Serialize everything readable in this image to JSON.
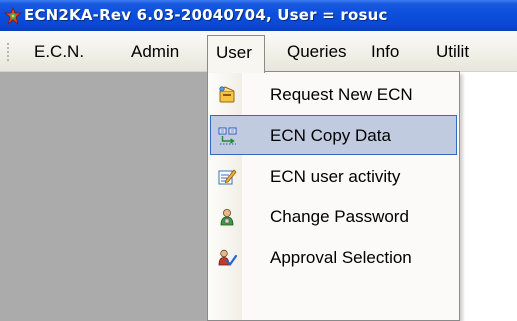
{
  "window": {
    "title": "ECN2KA-Rev 6.03-20040704, User = rosuc"
  },
  "menubar": {
    "items": [
      {
        "label": "E.C.N."
      },
      {
        "label": "Admin"
      },
      {
        "label": "User",
        "state": "open"
      },
      {
        "label": "Queries"
      },
      {
        "label": "Info"
      },
      {
        "label": "Utilit"
      }
    ]
  },
  "user_menu": {
    "items": [
      {
        "label": "Request New ECN",
        "icon": "request-ecn-icon"
      },
      {
        "label": "ECN Copy Data",
        "icon": "copy-data-icon",
        "highlighted": true
      },
      {
        "label": "ECN user activity",
        "icon": "edit-activity-icon"
      },
      {
        "label": "Change Password",
        "icon": "user-password-icon"
      },
      {
        "label": "Approval Selection",
        "icon": "user-approval-icon"
      }
    ]
  },
  "colors": {
    "titlebar": "#0b4fdd",
    "workspace": "#ababab",
    "highlight_fill": "#c1cbdf",
    "highlight_border": "#316ac5"
  }
}
